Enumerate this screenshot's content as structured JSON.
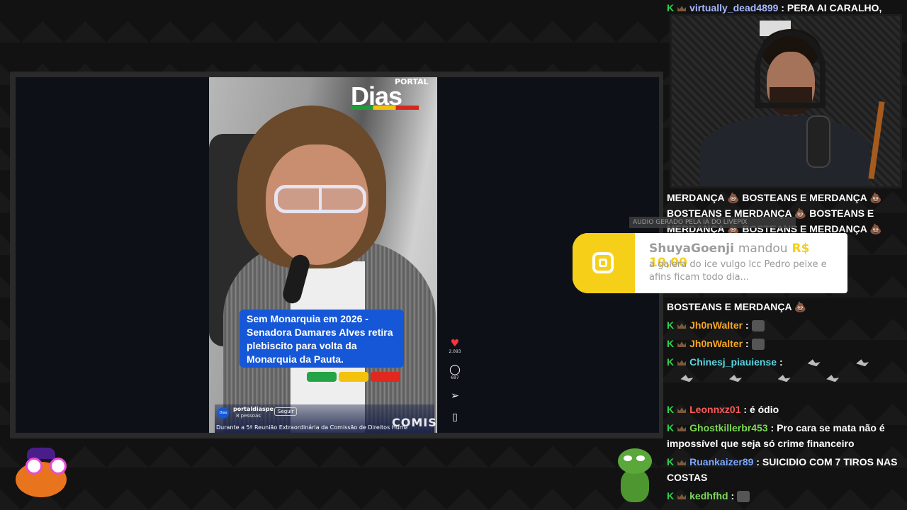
{
  "player": {
    "logo_word": "Dias",
    "logo_portal": "PORTAL",
    "caption": "Sem Monarquia em 2026 - Senadora Damares Alves retira plebiscito para volta da Monarquia da Pauta.",
    "channel_avatar": "Dias",
    "channel_name": "portaldiaspe",
    "channel_sub": "8 pessoas",
    "follow_label": "Seguir",
    "description": "Durante a 5ª Reunião Extraordinária da Comissão de Direitos Humanos",
    "watermark": "COMIS",
    "likes": "2.093",
    "comments": "697",
    "like_icon": "heart-icon",
    "comment_icon": "comment-icon",
    "share_icon": "share-icon",
    "save_icon": "bookmark-icon"
  },
  "alert": {
    "label": "AUDIO GERADO PELA IA DO LIVEPIX",
    "name": "ShuyaGoenji",
    "verb": "mandou",
    "value": "R$ 10,00",
    "text": "a galera do ice vulgo lcc Pedro peixe e afins ficam todo dia..."
  },
  "chat": {
    "messages": [
      {
        "user": "virtually_dead4899",
        "color": "#a8b8ff",
        "text": "PERA AI CARALHO,"
      },
      {
        "user": "",
        "color": "#ffffff",
        "text": "MERDANÇA 💩 BOSTEANS E MERDANÇA 💩"
      },
      {
        "user": "",
        "color": "#ffffff",
        "text": "BOSTEANS E MERDANÇA 💩 BOSTEANS E"
      },
      {
        "user": "",
        "color": "#ffffff",
        "text": "MERDANÇA 💩 BOSTEANS E MERDANÇA 💩"
      },
      {
        "user": "",
        "color": "#ffffff",
        "text": "BOSTEANS E MERDANÇA 💩"
      },
      {
        "user": "Jh0nWalter",
        "color": "#f5a623",
        "text": ""
      },
      {
        "user": "Jh0nWalter",
        "color": "#f5a623",
        "text": ""
      },
      {
        "user": "Chinesj_piauiense",
        "color": "#56d4e0",
        "text": ""
      },
      {
        "user": "Leonnxz01",
        "color": "#ff5a5a",
        "text": "é ódio"
      },
      {
        "user": "Ghostkillerbr453",
        "color": "#7dd957",
        "text": "Pro cara se mata não é"
      },
      {
        "user": "",
        "color": "#ffffff",
        "text": "impossível que seja só crime financeiro"
      },
      {
        "user": "Ruankaizer89",
        "color": "#7aa8ff",
        "text": "SUICIDIO COM 7 TIROS NAS"
      },
      {
        "user": "",
        "color": "#ffffff",
        "text": "COSTAS"
      },
      {
        "user": "kedhfhd",
        "color": "#7dd957",
        "text": ""
      }
    ]
  },
  "icons": {
    "k_badge": "K",
    "mod_badge": "crown-icon"
  }
}
